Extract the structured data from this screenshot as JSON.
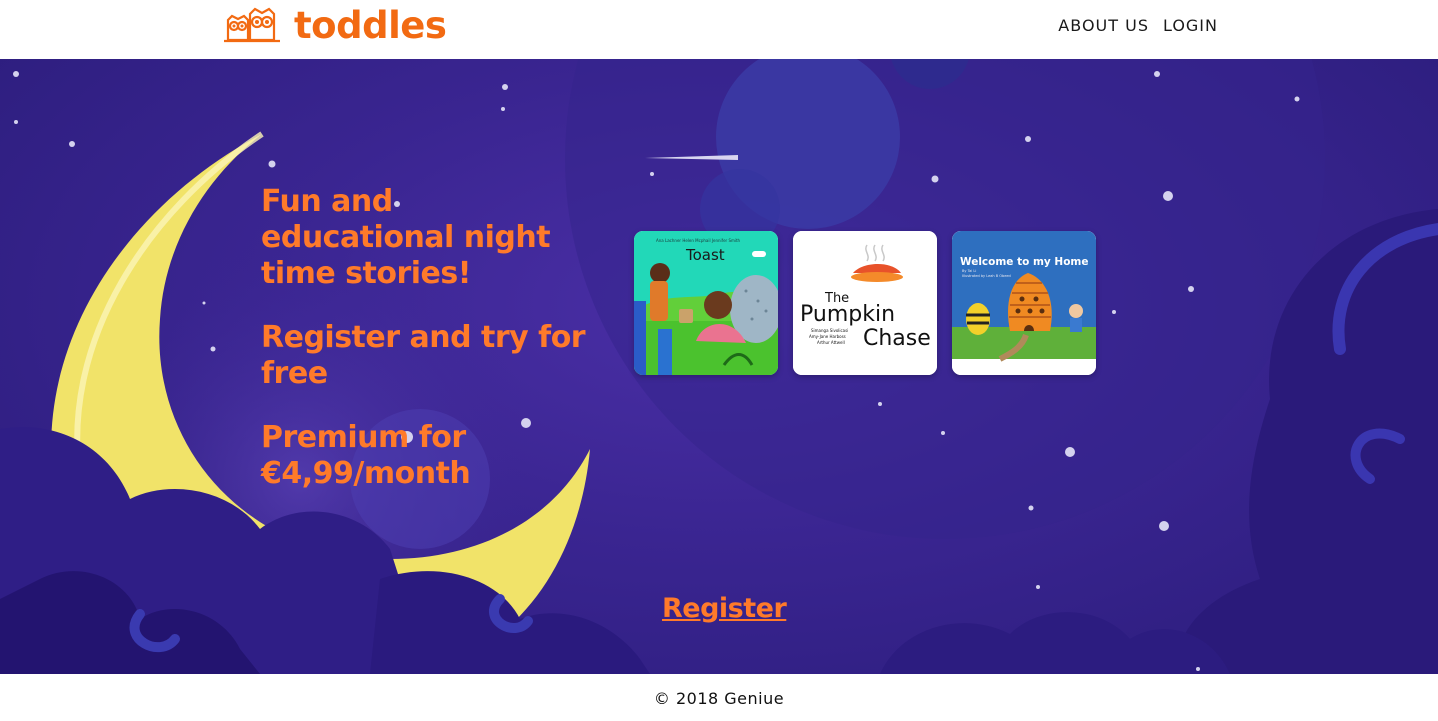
{
  "header": {
    "brand": "toddles",
    "nav": [
      {
        "label": "ABOUT US"
      },
      {
        "label": "LOGIN"
      }
    ]
  },
  "hero": {
    "taglines": [
      "Fun and educational night time stories!",
      "Register and try for free",
      "Premium for €4,99/month"
    ],
    "books": [
      {
        "title": "Toast",
        "credits": [
          "Ana Lachner",
          "Helen Mcphail",
          "Jennifer Smith"
        ],
        "cover_color": "#1ed6b6"
      },
      {
        "title_line1": "The",
        "title_line2": "Pumpkin",
        "title_line3": "Chase",
        "credits": [
          "Simangа Sivoliсаsі",
          "Amy-Jane Harboss",
          "Arthur Attwell"
        ]
      },
      {
        "title": "Welcome to my Home",
        "credits": [
          "By Tai Li",
          "Illustrated by Leah B Obeed"
        ],
        "cover_color": "#2a78c8"
      }
    ],
    "register_label": "Register"
  },
  "footer": {
    "copyright": "© 2018 Geniue"
  },
  "colors": {
    "accent": "#ff7a2a",
    "brand": "#f26a12",
    "sky": "#3a2591"
  }
}
